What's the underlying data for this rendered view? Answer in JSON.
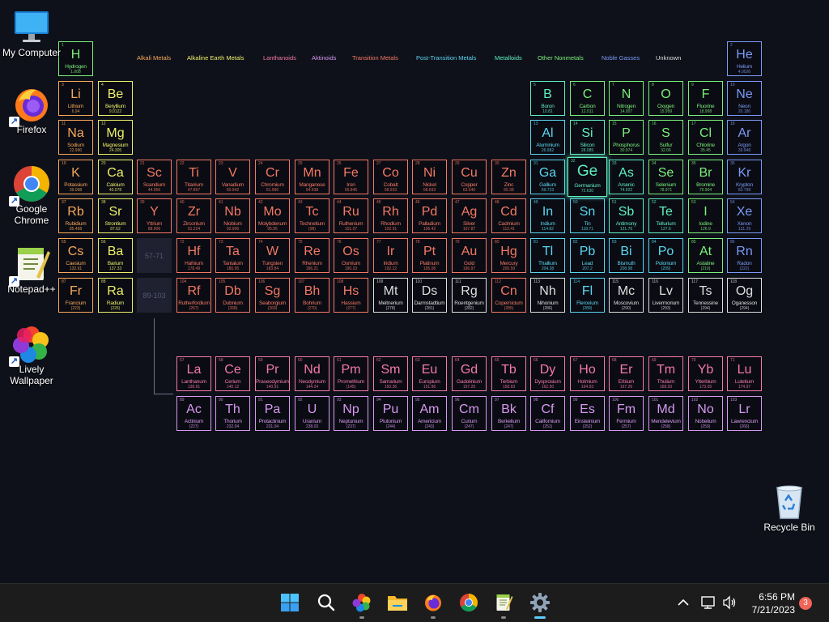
{
  "desktop": {
    "icons": [
      {
        "label": "My Computer",
        "icon": "monitor-icon"
      },
      {
        "label": "Firefox",
        "icon": "firefox-icon"
      },
      {
        "label": "Google Chrome",
        "icon": "chrome-icon"
      },
      {
        "label": "Notepad++",
        "icon": "notepadpp-icon"
      },
      {
        "label": "Lively Wallpaper",
        "icon": "lively-wallpaper-icon"
      },
      {
        "label": "Recycle Bin",
        "icon": "recycle-bin-icon"
      }
    ]
  },
  "periodic_table": {
    "legend": [
      {
        "label": "Alkali Metals",
        "color": "#f6a85a"
      },
      {
        "label": "Alkaline Earth Metals",
        "color": "#eef06a"
      },
      {
        "label": "Lanthanoids",
        "color": "#f47aa6"
      },
      {
        "label": "Aktinoids",
        "color": "#d69af0"
      },
      {
        "label": "Transition Metals",
        "color": "#f47864"
      },
      {
        "label": "Post-Transition Metals",
        "color": "#5ad6f0"
      },
      {
        "label": "Metalloids",
        "color": "#5ef0c0"
      },
      {
        "label": "Other Nonmetals",
        "color": "#7af07a"
      },
      {
        "label": "Noble Gasses",
        "color": "#7a9af6"
      },
      {
        "label": "Unknown",
        "color": "#dedede"
      }
    ],
    "placeholders": [
      "57-71",
      "89-103"
    ],
    "elements": [
      [
        "1",
        "H",
        "Hydrogen",
        "1.008",
        "o",
        1,
        1
      ],
      [
        "2",
        "He",
        "Helium",
        "4.0026",
        "n",
        18,
        1
      ],
      [
        "3",
        "Li",
        "Lithium",
        "6.94",
        "a",
        1,
        2
      ],
      [
        "4",
        "Be",
        "Beryllium",
        "9.0122",
        "e",
        2,
        2
      ],
      [
        "5",
        "B",
        "Boron",
        "10.81",
        "m",
        13,
        2
      ],
      [
        "6",
        "C",
        "Carbon",
        "12.011",
        "o",
        14,
        2
      ],
      [
        "7",
        "N",
        "Nitrogen",
        "14.007",
        "o",
        15,
        2
      ],
      [
        "8",
        "O",
        "Oxygen",
        "15.999",
        "o",
        16,
        2
      ],
      [
        "9",
        "F",
        "Fluorine",
        "18.998",
        "o",
        17,
        2
      ],
      [
        "10",
        "Ne",
        "Neon",
        "20.180",
        "n",
        18,
        2
      ],
      [
        "11",
        "Na",
        "Sodium",
        "22.990",
        "a",
        1,
        3
      ],
      [
        "12",
        "Mg",
        "Magnesium",
        "24.305",
        "e",
        2,
        3
      ],
      [
        "13",
        "Al",
        "Aluminium",
        "26.982",
        "p",
        13,
        3
      ],
      [
        "14",
        "Si",
        "Silicon",
        "28.085",
        "m",
        14,
        3
      ],
      [
        "15",
        "P",
        "Phosphorus",
        "30.974",
        "o",
        15,
        3
      ],
      [
        "16",
        "S",
        "Sulfur",
        "32.06",
        "o",
        16,
        3
      ],
      [
        "17",
        "Cl",
        "Chlorine",
        "35.45",
        "o",
        17,
        3
      ],
      [
        "18",
        "Ar",
        "Argon",
        "39.948",
        "n",
        18,
        3
      ],
      [
        "19",
        "K",
        "Potassium",
        "39.098",
        "a",
        1,
        4
      ],
      [
        "20",
        "Ca",
        "Calcium",
        "40.078",
        "e",
        2,
        4
      ],
      [
        "21",
        "Sc",
        "Scandium",
        "44.956",
        "t",
        3,
        4
      ],
      [
        "22",
        "Ti",
        "Titanium",
        "47.867",
        "t",
        4,
        4
      ],
      [
        "23",
        "V",
        "Vanadium",
        "50.942",
        "t",
        5,
        4
      ],
      [
        "24",
        "Cr",
        "Chromium",
        "51.996",
        "t",
        6,
        4
      ],
      [
        "25",
        "Mn",
        "Manganese",
        "54.938",
        "t",
        7,
        4
      ],
      [
        "26",
        "Fe",
        "Iron",
        "55.845",
        "t",
        8,
        4
      ],
      [
        "27",
        "Co",
        "Cobalt",
        "58.933",
        "t",
        9,
        4
      ],
      [
        "28",
        "Ni",
        "Nickel",
        "58.693",
        "t",
        10,
        4
      ],
      [
        "29",
        "Cu",
        "Copper",
        "63.546",
        "t",
        11,
        4
      ],
      [
        "30",
        "Zn",
        "Zinc",
        "65.38",
        "t",
        12,
        4
      ],
      [
        "31",
        "Ga",
        "Gallium",
        "69.723",
        "p",
        13,
        4
      ],
      [
        "32",
        "Ge",
        "Germanium",
        "72.630",
        "m",
        14,
        4
      ],
      [
        "33",
        "As",
        "Arsenic",
        "74.922",
        "m",
        15,
        4
      ],
      [
        "34",
        "Se",
        "Selenium",
        "78.971",
        "o",
        16,
        4
      ],
      [
        "35",
        "Br",
        "Bromine",
        "79.904",
        "o",
        17,
        4
      ],
      [
        "36",
        "Kr",
        "Krypton",
        "83.798",
        "n",
        18,
        4
      ],
      [
        "37",
        "Rb",
        "Rubidium",
        "85.468",
        "a",
        1,
        5
      ],
      [
        "38",
        "Sr",
        "Strontium",
        "87.62",
        "e",
        2,
        5
      ],
      [
        "39",
        "Y",
        "Yttrium",
        "88.906",
        "t",
        3,
        5
      ],
      [
        "40",
        "Zr",
        "Zirconium",
        "91.224",
        "t",
        4,
        5
      ],
      [
        "41",
        "Nb",
        "Niobium",
        "92.906",
        "t",
        5,
        5
      ],
      [
        "42",
        "Mo",
        "Molybdenum",
        "95.95",
        "t",
        6,
        5
      ],
      [
        "43",
        "Tc",
        "Technetium",
        "(98)",
        "t",
        7,
        5
      ],
      [
        "44",
        "Ru",
        "Ruthenium",
        "101.07",
        "t",
        8,
        5
      ],
      [
        "45",
        "Rh",
        "Rhodium",
        "102.91",
        "t",
        9,
        5
      ],
      [
        "46",
        "Pd",
        "Palladium",
        "106.42",
        "t",
        10,
        5
      ],
      [
        "47",
        "Ag",
        "Silver",
        "107.87",
        "t",
        11,
        5
      ],
      [
        "48",
        "Cd",
        "Cadmium",
        "112.41",
        "t",
        12,
        5
      ],
      [
        "49",
        "In",
        "Indium",
        "114.82",
        "p",
        13,
        5
      ],
      [
        "50",
        "Sn",
        "Tin",
        "118.71",
        "p",
        14,
        5
      ],
      [
        "51",
        "Sb",
        "Antimony",
        "121.76",
        "m",
        15,
        5
      ],
      [
        "52",
        "Te",
        "Tellurium",
        "127.6",
        "m",
        16,
        5
      ],
      [
        "53",
        "I",
        "Iodine",
        "126.9",
        "o",
        17,
        5
      ],
      [
        "54",
        "Xe",
        "Xenon",
        "131.29",
        "n",
        18,
        5
      ],
      [
        "55",
        "Cs",
        "Caesium",
        "132.91",
        "a",
        1,
        6
      ],
      [
        "56",
        "Ba",
        "Barium",
        "137.33",
        "e",
        2,
        6
      ],
      [
        "72",
        "Hf",
        "Hafnium",
        "178.49",
        "t",
        4,
        6
      ],
      [
        "73",
        "Ta",
        "Tantalum",
        "180.95",
        "t",
        5,
        6
      ],
      [
        "74",
        "W",
        "Tungsten",
        "183.84",
        "t",
        6,
        6
      ],
      [
        "75",
        "Re",
        "Rhenium",
        "186.21",
        "t",
        7,
        6
      ],
      [
        "76",
        "Os",
        "Osmium",
        "190.23",
        "t",
        8,
        6
      ],
      [
        "77",
        "Ir",
        "Iridium",
        "192.22",
        "t",
        9,
        6
      ],
      [
        "78",
        "Pt",
        "Platinum",
        "195.08",
        "t",
        10,
        6
      ],
      [
        "79",
        "Au",
        "Gold",
        "196.97",
        "t",
        11,
        6
      ],
      [
        "80",
        "Hg",
        "Mercury",
        "200.59",
        "t",
        12,
        6
      ],
      [
        "81",
        "Tl",
        "Thallium",
        "204.38",
        "p",
        13,
        6
      ],
      [
        "82",
        "Pb",
        "Lead",
        "207.2",
        "p",
        14,
        6
      ],
      [
        "83",
        "Bi",
        "Bismuth",
        "208.98",
        "p",
        15,
        6
      ],
      [
        "84",
        "Po",
        "Polonium",
        "(209)",
        "p",
        16,
        6
      ],
      [
        "85",
        "At",
        "Astatine",
        "(210)",
        "o",
        17,
        6
      ],
      [
        "86",
        "Rn",
        "Radon",
        "(222)",
        "n",
        18,
        6
      ],
      [
        "87",
        "Fr",
        "Francium",
        "(223)",
        "a",
        1,
        7
      ],
      [
        "88",
        "Ra",
        "Radium",
        "(226)",
        "e",
        2,
        7
      ],
      [
        "104",
        "Rf",
        "Rutherfordium",
        "(267)",
        "t",
        4,
        7
      ],
      [
        "105",
        "Db",
        "Dubnium",
        "(268)",
        "t",
        5,
        7
      ],
      [
        "106",
        "Sg",
        "Seaborgium",
        "(269)",
        "t",
        6,
        7
      ],
      [
        "107",
        "Bh",
        "Bohrium",
        "(270)",
        "t",
        7,
        7
      ],
      [
        "108",
        "Hs",
        "Hassium",
        "(277)",
        "t",
        8,
        7
      ],
      [
        "109",
        "Mt",
        "Meitnerium",
        "(278)",
        "u",
        9,
        7
      ],
      [
        "110",
        "Ds",
        "Darmstadtium",
        "(281)",
        "u",
        10,
        7
      ],
      [
        "111",
        "Rg",
        "Roentgenium",
        "(282)",
        "u",
        11,
        7
      ],
      [
        "112",
        "Cn",
        "Copernicium",
        "(285)",
        "t",
        12,
        7
      ],
      [
        "113",
        "Nh",
        "Nihonium",
        "(286)",
        "u",
        13,
        7
      ],
      [
        "114",
        "Fl",
        "Flerovium",
        "(289)",
        "p",
        14,
        7
      ],
      [
        "115",
        "Mc",
        "Moscovium",
        "(290)",
        "u",
        15,
        7
      ],
      [
        "116",
        "Lv",
        "Livermorium",
        "(293)",
        "u",
        16,
        7
      ],
      [
        "117",
        "Ts",
        "Tennessine",
        "(294)",
        "u",
        17,
        7
      ],
      [
        "118",
        "Og",
        "Oganesson",
        "(294)",
        "u",
        18,
        7
      ],
      [
        "57",
        "La",
        "Lanthanum",
        "138.91",
        "l",
        4,
        9
      ],
      [
        "58",
        "Ce",
        "Cerium",
        "140.12",
        "l",
        5,
        9
      ],
      [
        "59",
        "Pr",
        "Praseodymium",
        "140.91",
        "l",
        6,
        9
      ],
      [
        "60",
        "Nd",
        "Neodymium",
        "144.24",
        "l",
        7,
        9
      ],
      [
        "61",
        "Pm",
        "Promethium",
        "(145)",
        "l",
        8,
        9
      ],
      [
        "62",
        "Sm",
        "Samarium",
        "150.36",
        "l",
        9,
        9
      ],
      [
        "63",
        "Eu",
        "Europium",
        "151.96",
        "l",
        10,
        9
      ],
      [
        "64",
        "Gd",
        "Gadolinium",
        "157.25",
        "l",
        11,
        9
      ],
      [
        "65",
        "Tb",
        "Terbium",
        "158.93",
        "l",
        12,
        9
      ],
      [
        "66",
        "Dy",
        "Dysprosium",
        "162.50",
        "l",
        13,
        9
      ],
      [
        "67",
        "Ho",
        "Holmium",
        "164.93",
        "l",
        14,
        9
      ],
      [
        "68",
        "Er",
        "Erbium",
        "167.26",
        "l",
        15,
        9
      ],
      [
        "69",
        "Tm",
        "Thulium",
        "168.93",
        "l",
        16,
        9
      ],
      [
        "70",
        "Yb",
        "Ytterbium",
        "173.05",
        "l",
        17,
        9
      ],
      [
        "71",
        "Lu",
        "Lutetium",
        "174.97",
        "l",
        18,
        9
      ],
      [
        "89",
        "Ac",
        "Actinium",
        "(227)",
        "k",
        4,
        10
      ],
      [
        "90",
        "Th",
        "Thorium",
        "232.04",
        "k",
        5,
        10
      ],
      [
        "91",
        "Pa",
        "Protactinium",
        "231.04",
        "k",
        6,
        10
      ],
      [
        "92",
        "U",
        "Uranium",
        "238.03",
        "k",
        7,
        10
      ],
      [
        "93",
        "Np",
        "Neptunium",
        "(237)",
        "k",
        8,
        10
      ],
      [
        "94",
        "Pu",
        "Plutonium",
        "(244)",
        "k",
        9,
        10
      ],
      [
        "95",
        "Am",
        "Americium",
        "(243)",
        "k",
        10,
        10
      ],
      [
        "96",
        "Cm",
        "Curium",
        "(247)",
        "k",
        11,
        10
      ],
      [
        "97",
        "Bk",
        "Berkelium",
        "(247)",
        "k",
        12,
        10
      ],
      [
        "98",
        "Cf",
        "Californium",
        "(251)",
        "k",
        13,
        10
      ],
      [
        "99",
        "Es",
        "Einsteinium",
        "(252)",
        "k",
        14,
        10
      ],
      [
        "100",
        "Fm",
        "Fermium",
        "(257)",
        "k",
        15,
        10
      ],
      [
        "101",
        "Md",
        "Mendelevium",
        "(258)",
        "k",
        16,
        10
      ],
      [
        "102",
        "No",
        "Nobelium",
        "(259)",
        "k",
        17,
        10
      ],
      [
        "103",
        "Lr",
        "Lawrencium",
        "(266)",
        "k",
        18,
        10
      ]
    ],
    "category_colors": {
      "a": "#f6a85a",
      "e": "#eef06a",
      "l": "#f47aa6",
      "k": "#d69af0",
      "t": "#f47864",
      "p": "#5ad6f0",
      "m": "#5ef0c0",
      "o": "#7af07a",
      "n": "#7a9af6",
      "u": "#dedede"
    },
    "highlighted": [
      "Ge"
    ]
  },
  "taskbar": {
    "apps": [
      {
        "name": "start-button",
        "icon": "windows-icon"
      },
      {
        "name": "search-button",
        "icon": "search-icon"
      },
      {
        "name": "lively-wallpaper-taskbar",
        "icon": "lively-wallpaper-icon"
      },
      {
        "name": "file-explorer-taskbar",
        "icon": "folder-icon"
      },
      {
        "name": "firefox-taskbar",
        "icon": "firefox-icon"
      },
      {
        "name": "chrome-taskbar",
        "icon": "chrome-icon"
      },
      {
        "name": "notepadpp-taskbar",
        "icon": "notepadpp-icon"
      },
      {
        "name": "settings-taskbar",
        "icon": "gear-icon"
      }
    ],
    "tray": {
      "time": "6:56 PM",
      "date": "7/21/2023",
      "notification_count": "3"
    }
  }
}
